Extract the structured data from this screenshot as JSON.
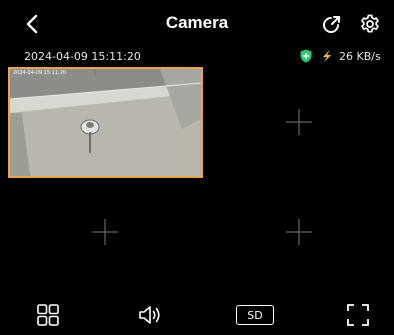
{
  "header": {
    "title": "Camera"
  },
  "status": {
    "timestamp": "2024-04-09 15:11:20",
    "speed": "26 KB/s"
  },
  "feed": {
    "overlay_timestamp": "2024-04-09 15:11:20"
  },
  "toolbar": {
    "quality_label": "SD"
  },
  "icons": {
    "back": "chevron-left-icon",
    "share": "share-arrow-icon",
    "settings": "gear-icon",
    "shield": "shield-plus-icon",
    "network": "lightning-icon",
    "add": "plus-icon",
    "layout": "grid-layout-icon",
    "sound": "speaker-icon",
    "fullscreen": "fullscreen-icon"
  },
  "colors": {
    "selection_border": "#e8a64a",
    "shield": "#2ecc71",
    "bolt": "#f2c230"
  }
}
